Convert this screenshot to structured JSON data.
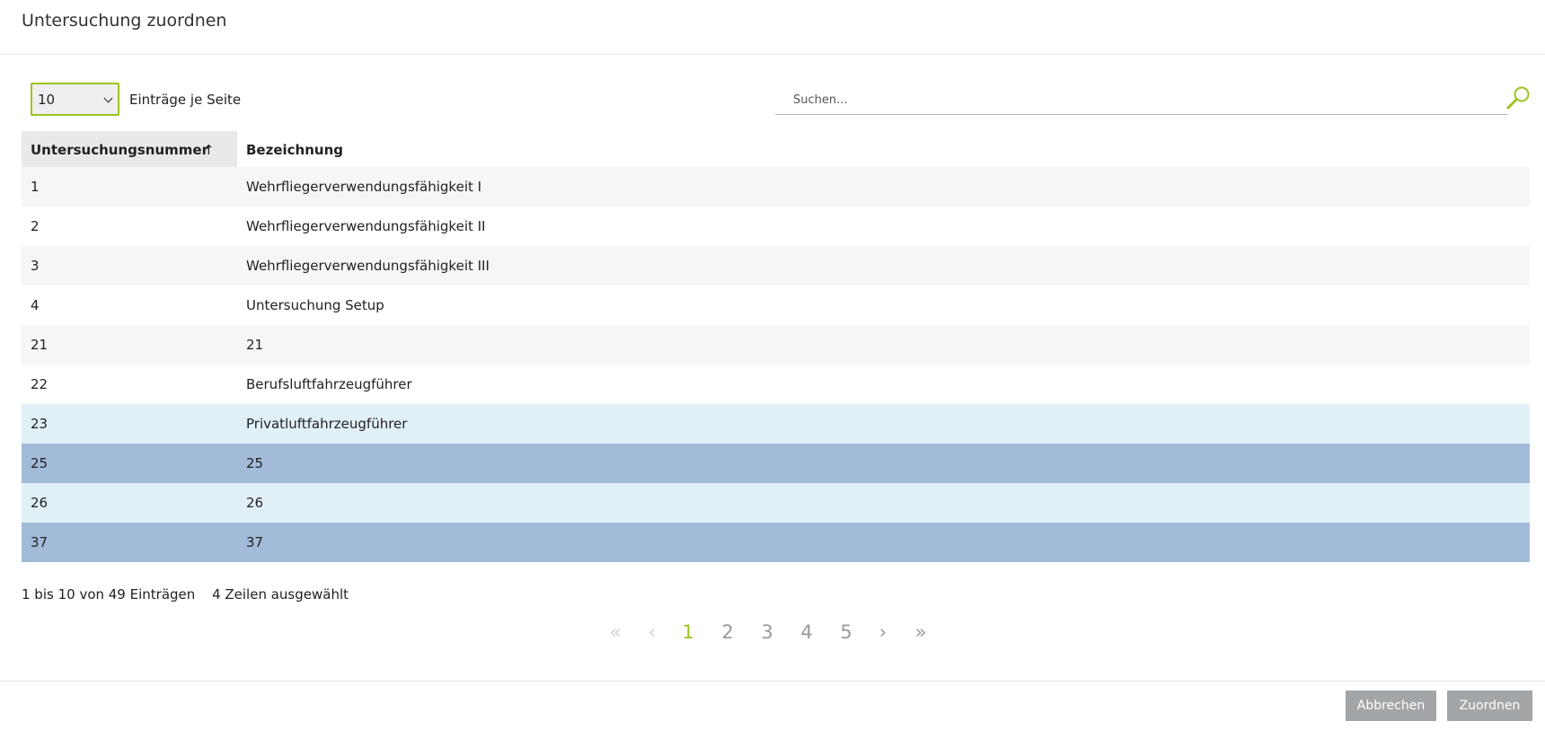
{
  "dialog": {
    "title": "Untersuchung zuordnen"
  },
  "controls": {
    "page_length": "10",
    "page_length_label": "Einträge je Seite",
    "search_placeholder": "Suchen..."
  },
  "table": {
    "headers": [
      "Untersuchungsnummer",
      "Bezeichnung"
    ],
    "sort_indicator": "↑",
    "rows": [
      {
        "nr": "1",
        "name": "Wehrfliegerverwendungsfähigkeit I",
        "state": "odd"
      },
      {
        "nr": "2",
        "name": "Wehrfliegerverwendungsfähigkeit II",
        "state": "even"
      },
      {
        "nr": "3",
        "name": "Wehrfliegerverwendungsfähigkeit III",
        "state": "odd"
      },
      {
        "nr": "4",
        "name": "Untersuchung Setup",
        "state": "even"
      },
      {
        "nr": "21",
        "name": "21",
        "state": "odd"
      },
      {
        "nr": "22",
        "name": "Berufsluftfahrzeugführer",
        "state": "even"
      },
      {
        "nr": "23",
        "name": "Privatluftfahrzeugführer",
        "state": "hover"
      },
      {
        "nr": "25",
        "name": "25",
        "state": "selected"
      },
      {
        "nr": "26",
        "name": "26",
        "state": "hover"
      },
      {
        "nr": "37",
        "name": "37",
        "state": "selected"
      }
    ]
  },
  "info": {
    "range": "1 bis 10 von 49 Einträgen",
    "selected": "4 Zeilen ausgewählt"
  },
  "pagination": {
    "first": "«",
    "prev": "‹",
    "pages": [
      "1",
      "2",
      "3",
      "4",
      "5"
    ],
    "next": "›",
    "last": "»",
    "current_page": "1"
  },
  "footer": {
    "cancel_label": "Abbrechen",
    "assign_label": "Zuordnen"
  },
  "colors": {
    "accent": "#9bc31c",
    "selected_row": "#a2bbd9",
    "hover_row": "#e1f0f7",
    "button": "#a3a6a8"
  }
}
